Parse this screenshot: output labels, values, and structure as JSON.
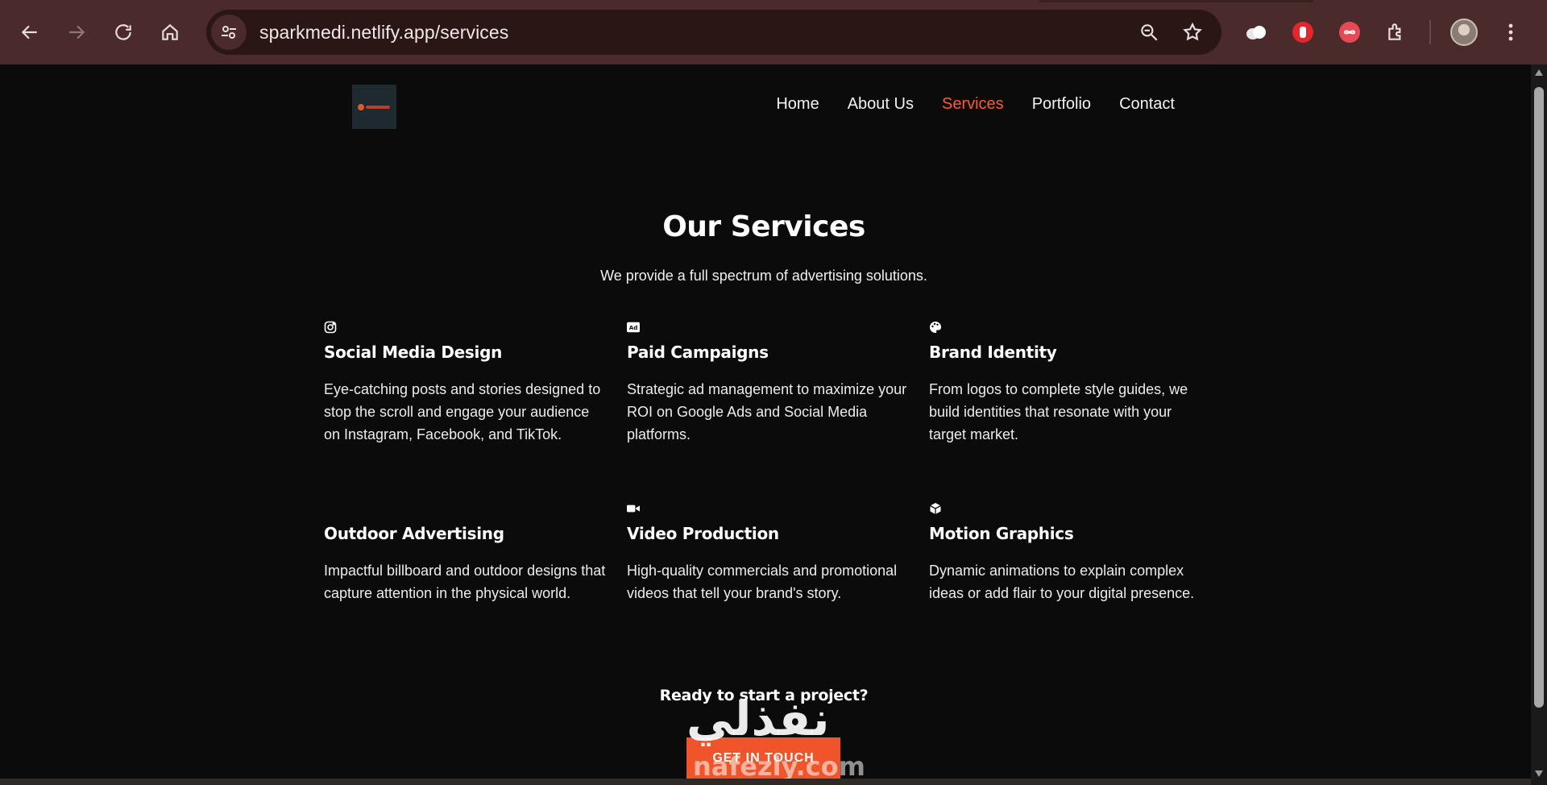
{
  "browser": {
    "url": "sparkmedi.netlify.app/services"
  },
  "nav": {
    "items": [
      {
        "label": "Home",
        "active": false
      },
      {
        "label": "About Us",
        "active": false
      },
      {
        "label": "Services",
        "active": true
      },
      {
        "label": "Portfolio",
        "active": false
      },
      {
        "label": "Contact",
        "active": false
      }
    ]
  },
  "hero": {
    "title": "Our Services",
    "subtitle": "We provide a full spectrum of advertising solutions."
  },
  "services": [
    {
      "icon": "instagram-icon",
      "title": "Social Media Design",
      "description": "Eye-catching posts and stories designed to stop the scroll and engage your audience on Instagram, Facebook, and TikTok."
    },
    {
      "icon": "ad-icon",
      "title": "Paid Campaigns",
      "description": "Strategic ad management to maximize your ROI on Google Ads and Social Media platforms."
    },
    {
      "icon": "palette-icon",
      "title": "Brand Identity",
      "description": "From logos to complete style guides, we build identities that resonate with your target market."
    },
    {
      "icon": "billboard-icon",
      "title": "Outdoor Advertising",
      "description": "Impactful billboard and outdoor designs that capture attention in the physical world."
    },
    {
      "icon": "video-camera-icon",
      "title": "Video Production",
      "description": "High-quality commercials and promotional videos that tell your brand's story."
    },
    {
      "icon": "cube-icon",
      "title": "Motion Graphics",
      "description": "Dynamic animations to explain complex ideas or add flair to your digital presence."
    }
  ],
  "cta": {
    "title": "Ready to start a project?",
    "button_label": "GET IN TOUCH"
  },
  "watermark": {
    "arabic": "نفذلي",
    "latin": "nafezly.com"
  },
  "colors": {
    "accent": "#ff5a2c",
    "button": "#f0542a",
    "background": "#0b0b0b",
    "chrome": "#4a2a2a"
  }
}
